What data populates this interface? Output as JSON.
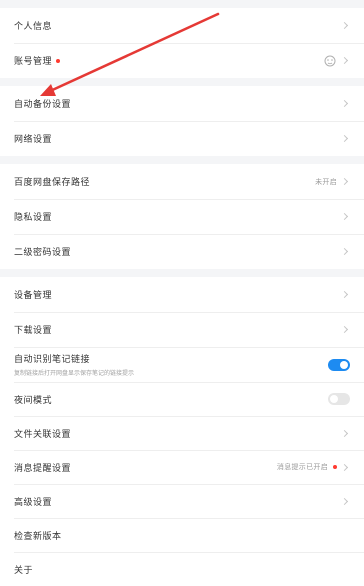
{
  "settings": {
    "profile": "个人信息",
    "account": "账号管理",
    "auto_backup": "自动备份设置",
    "network": "网络设置",
    "baidu_pan": "百度网盘保存路径",
    "baidu_pan_value": "未开启",
    "privacy": "隐私设置",
    "passcode": "二级密码设置",
    "device": "设备管理",
    "download": "下载设置",
    "link": {
      "title": "自动识别笔记链接",
      "desc": "复制链接后打开网盘显示保存笔记的链接提示"
    },
    "night_mode": "夜间模式",
    "file_assoc": "文件关联设置",
    "notify": "消息提醒设置",
    "notify_value": "消息提示已开启",
    "advanced": "高级设置",
    "update": "检查新版本",
    "about": "关于"
  },
  "toggles": {
    "link": true,
    "night_mode": false
  },
  "colors": {
    "accent": "#1d8bf1",
    "badge": "#ff3b30",
    "annotation_arrow": "#e53935"
  },
  "icons": {
    "account": "account-avatar-icon",
    "chevron": "chevron-right-icon"
  }
}
